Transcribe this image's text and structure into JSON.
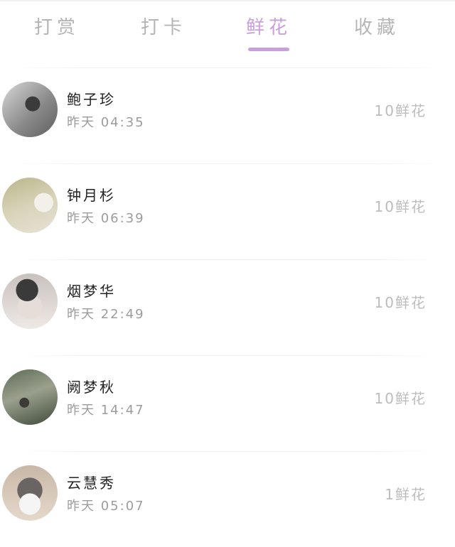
{
  "colors": {
    "accent": "#c9a0dc"
  },
  "tabs": [
    {
      "label": "打赏"
    },
    {
      "label": "打卡"
    },
    {
      "label": "鲜花",
      "active": true
    },
    {
      "label": "收藏"
    }
  ],
  "list": [
    {
      "name": "鲍子珍",
      "time": "昨天 04:35",
      "flowers": "10鲜花",
      "avatar": "avatar-photo"
    },
    {
      "name": "钟月杉",
      "time": "昨天 06:39",
      "flowers": "10鲜花",
      "avatar": "avatar-photo"
    },
    {
      "name": "烟梦华",
      "time": "昨天 22:49",
      "flowers": "10鲜花",
      "avatar": "avatar-photo"
    },
    {
      "name": "阙梦秋",
      "time": "昨天 14:47",
      "flowers": "10鲜花",
      "avatar": "avatar-photo"
    },
    {
      "name": "云慧秀",
      "time": "昨天 05:07",
      "flowers": "1鲜花",
      "avatar": "husky-avatar"
    }
  ]
}
